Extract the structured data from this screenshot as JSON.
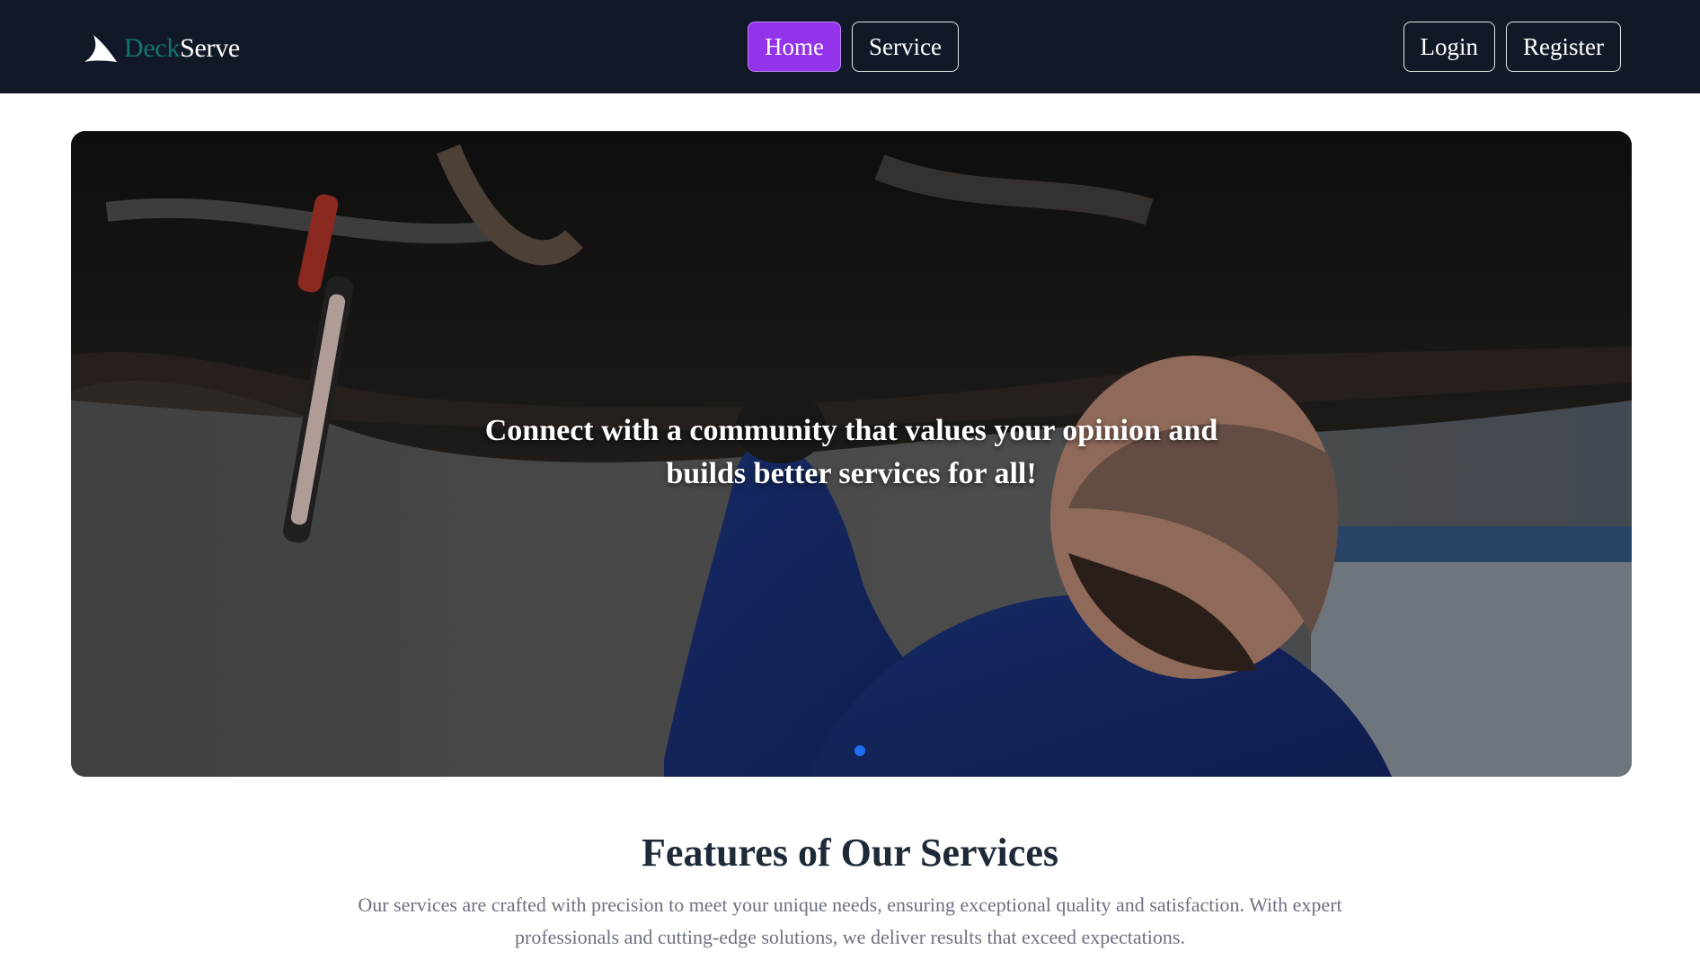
{
  "brand": {
    "name_part1": "Deck",
    "name_part2": "Serve",
    "logo_icon": "sail-logo-icon",
    "color_part1": "#0f766e",
    "color_part2": "#ffffff"
  },
  "nav": {
    "center": [
      {
        "label": "Home",
        "active": true
      },
      {
        "label": "Service",
        "active": false
      }
    ],
    "right": [
      {
        "label": "Login"
      },
      {
        "label": "Register"
      }
    ],
    "background": "#111827",
    "active_color": "#9333ea"
  },
  "hero": {
    "caption_line1": "Connect with a community that values your opinion and",
    "caption_line2": "builds better services for all!",
    "slide_count": 1,
    "active_slide": 1,
    "dot_color": "#1d6ff2"
  },
  "features": {
    "title": "Features of Our Services",
    "description": "Our services are crafted with precision to meet your unique needs, ensuring exceptional quality and satisfaction. With expert professionals and cutting-edge solutions, we deliver results that exceed expectations."
  }
}
